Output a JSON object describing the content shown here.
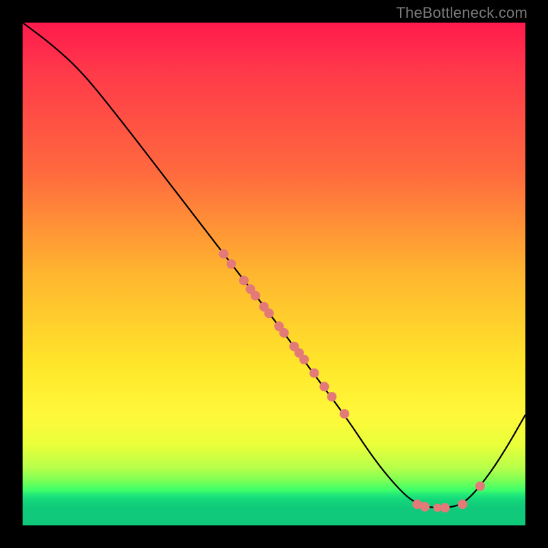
{
  "watermark": "TheBottleneck.com",
  "chart_data": {
    "type": "line",
    "title": "",
    "xlabel": "",
    "ylabel": "",
    "xlim": [
      0,
      100
    ],
    "ylim": [
      0,
      100
    ],
    "curve": [
      {
        "x": 0,
        "y": 100
      },
      {
        "x": 6,
        "y": 95.5
      },
      {
        "x": 12,
        "y": 90
      },
      {
        "x": 20,
        "y": 80
      },
      {
        "x": 30,
        "y": 67
      },
      {
        "x": 40,
        "y": 54
      },
      {
        "x": 50,
        "y": 41
      },
      {
        "x": 58,
        "y": 30
      },
      {
        "x": 64,
        "y": 22
      },
      {
        "x": 70,
        "y": 13
      },
      {
        "x": 75,
        "y": 7
      },
      {
        "x": 78,
        "y": 4.5
      },
      {
        "x": 81,
        "y": 3.5
      },
      {
        "x": 85,
        "y": 3.5
      },
      {
        "x": 88,
        "y": 4.5
      },
      {
        "x": 92,
        "y": 9
      },
      {
        "x": 96,
        "y": 15
      },
      {
        "x": 100,
        "y": 22
      }
    ],
    "dots_upper": [
      {
        "x": 40,
        "y": 54,
        "r": 7
      },
      {
        "x": 41.5,
        "y": 52,
        "r": 7
      },
      {
        "x": 44,
        "y": 48.7,
        "r": 7
      },
      {
        "x": 45.3,
        "y": 47,
        "r": 7
      },
      {
        "x": 46.3,
        "y": 45.7,
        "r": 7
      },
      {
        "x": 48,
        "y": 43.5,
        "r": 7
      },
      {
        "x": 49,
        "y": 42.2,
        "r": 7
      },
      {
        "x": 51,
        "y": 39.6,
        "r": 7
      },
      {
        "x": 52,
        "y": 38.3,
        "r": 7
      },
      {
        "x": 54,
        "y": 35.6,
        "r": 7
      },
      {
        "x": 55,
        "y": 34.3,
        "r": 7
      },
      {
        "x": 56,
        "y": 33,
        "r": 7
      },
      {
        "x": 58,
        "y": 30.3,
        "r": 7
      },
      {
        "x": 60,
        "y": 27.6,
        "r": 7
      },
      {
        "x": 61.5,
        "y": 25.6,
        "r": 7
      },
      {
        "x": 64,
        "y": 22.2,
        "r": 7
      }
    ],
    "dots_lower": [
      {
        "x": 78.5,
        "y": 4.2,
        "r": 7
      },
      {
        "x": 80,
        "y": 3.7,
        "r": 7
      },
      {
        "x": 82.5,
        "y": 3.5,
        "r": 6
      },
      {
        "x": 84,
        "y": 3.5,
        "r": 7
      },
      {
        "x": 87.5,
        "y": 4.2,
        "r": 7
      },
      {
        "x": 91,
        "y": 7.8,
        "r": 7
      }
    ]
  }
}
